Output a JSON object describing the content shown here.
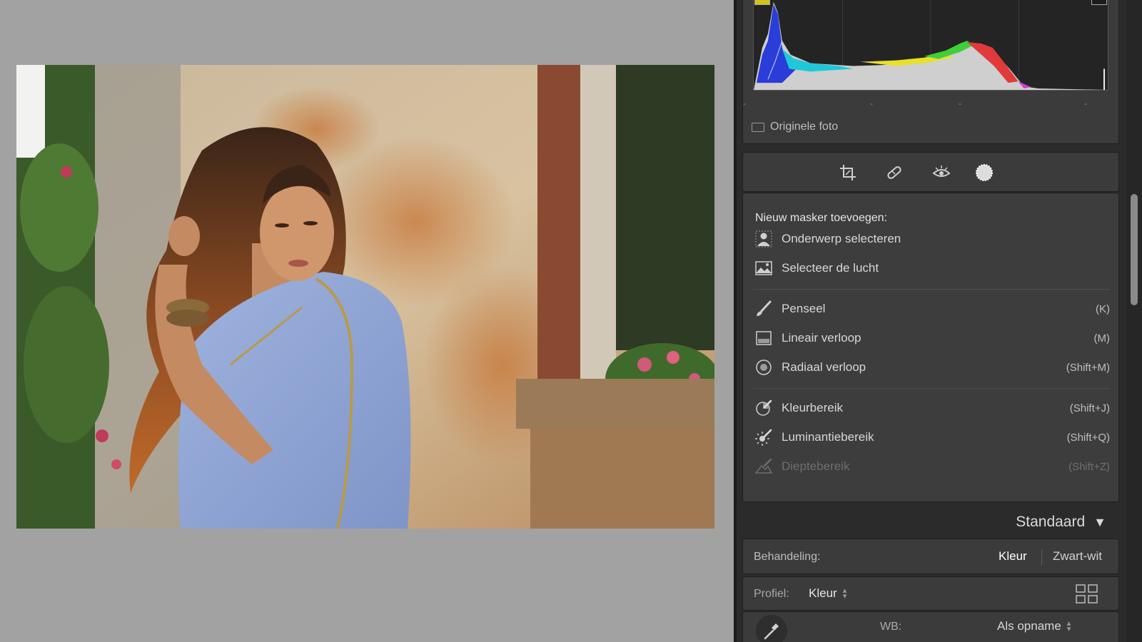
{
  "histogram": {
    "original_photo_label": "Originele foto",
    "tick_labels": [
      "-",
      "-",
      "-",
      "-"
    ]
  },
  "tools": [
    {
      "name": "crop-icon"
    },
    {
      "name": "healing-icon"
    },
    {
      "name": "red-eye-icon"
    },
    {
      "name": "masking-icon",
      "active": true
    }
  ],
  "mask_menu": {
    "title": "Nieuw masker toevoegen:",
    "items": [
      {
        "label": "Onderwerp selecteren",
        "shortcut": "",
        "icon": "subject-icon"
      },
      {
        "label": "Selecteer de lucht",
        "shortcut": "",
        "icon": "sky-icon"
      },
      {
        "label": "Penseel",
        "shortcut": "(K)",
        "icon": "brush-icon"
      },
      {
        "label": "Lineair verloop",
        "shortcut": "(M)",
        "icon": "linear-gradient-icon"
      },
      {
        "label": "Radiaal verloop",
        "shortcut": "(Shift+M)",
        "icon": "radial-gradient-icon"
      },
      {
        "label": "Kleurbereik",
        "shortcut": "(Shift+J)",
        "icon": "color-range-icon"
      },
      {
        "label": "Luminantiebereik",
        "shortcut": "(Shift+Q)",
        "icon": "luminance-range-icon"
      },
      {
        "label": "Dieptebereik",
        "shortcut": "(Shift+Z)",
        "icon": "depth-range-icon",
        "disabled": true
      }
    ]
  },
  "basic": {
    "header": "Standaard",
    "treatment_label": "Behandeling:",
    "treatment_color": "Kleur",
    "treatment_bw": "Zwart-wit",
    "profile_label": "Profiel:",
    "profile_value": "Kleur",
    "wb_label": "WB:",
    "wb_value": "Als opname"
  },
  "colors": {
    "panel_bg": "#2b2b2b",
    "card_bg": "#3b3b3b",
    "canvas_bg": "#a2a2a2"
  }
}
